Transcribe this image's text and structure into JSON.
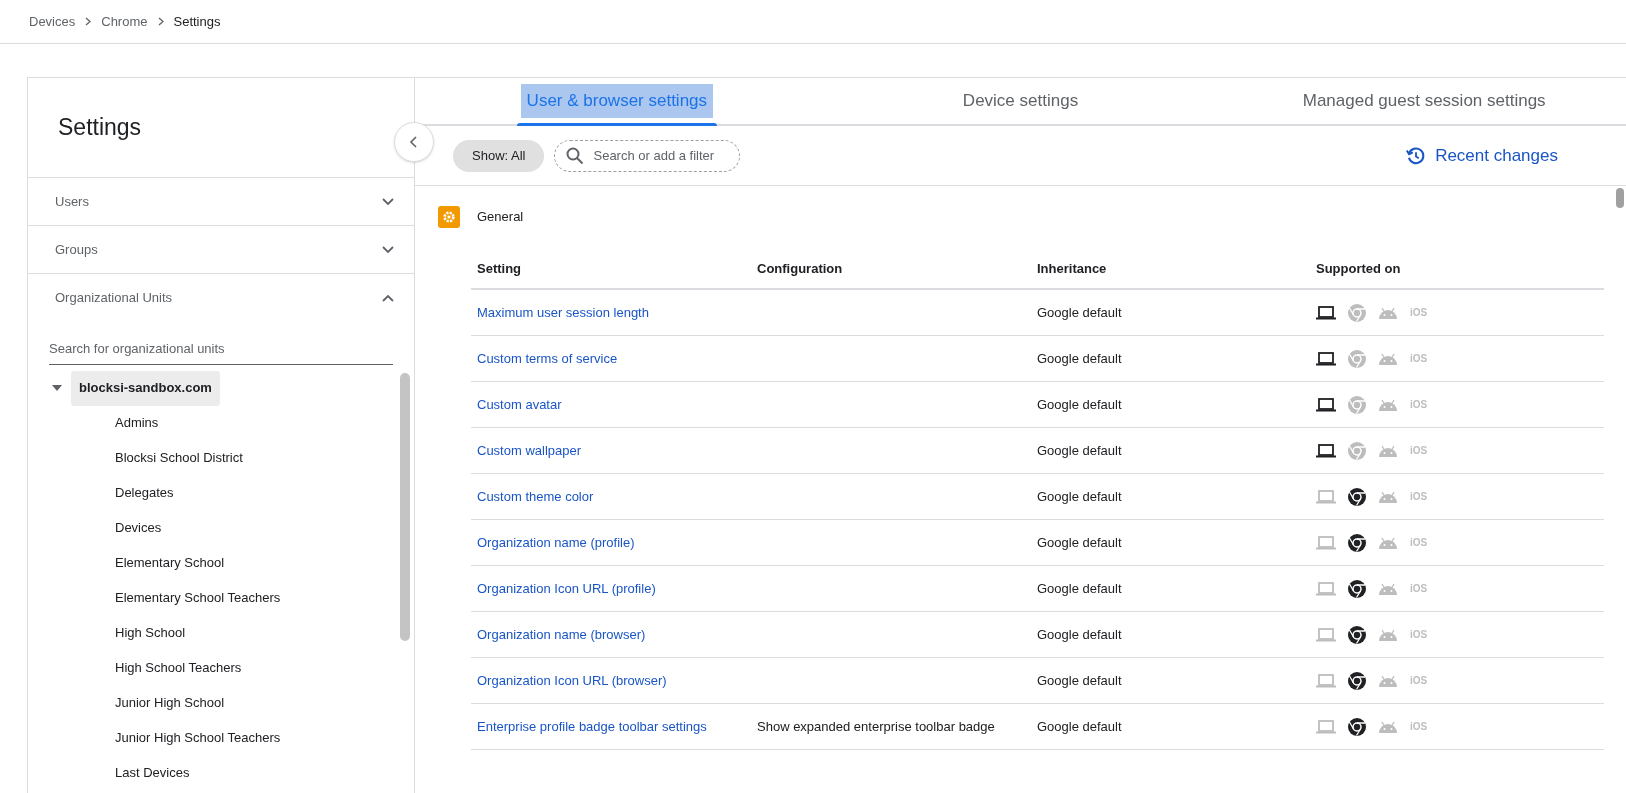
{
  "breadcrumb": [
    "Devices",
    "Chrome",
    "Settings"
  ],
  "sidebar": {
    "title": "Settings",
    "sections": [
      {
        "label": "Users",
        "expanded": false
      },
      {
        "label": "Groups",
        "expanded": false
      },
      {
        "label": "Organizational Units",
        "expanded": true
      }
    ],
    "ou_search": {
      "placeholder": "Search for organizational units"
    },
    "tree": [
      {
        "label": "blocksi-sandbox.com",
        "selected": true,
        "expanded": true,
        "children": [
          {
            "label": "Admins",
            "selected": false
          },
          {
            "label": "Blocksi School District",
            "selected": false
          },
          {
            "label": "Delegates",
            "selected": false
          },
          {
            "label": "Devices",
            "selected": false
          },
          {
            "label": "Elementary School",
            "selected": false
          },
          {
            "label": "Elementary School Teachers",
            "selected": false
          },
          {
            "label": "High School",
            "selected": false
          },
          {
            "label": "High School Teachers",
            "selected": false
          },
          {
            "label": "Junior High School",
            "selected": false
          },
          {
            "label": "Junior High School Teachers",
            "selected": false
          },
          {
            "label": "Last Devices",
            "selected": false
          }
        ]
      }
    ]
  },
  "tabs": [
    {
      "label": "User & browser settings",
      "selected": true
    },
    {
      "label": "Device settings",
      "selected": false
    },
    {
      "label": "Managed guest session settings",
      "selected": false
    }
  ],
  "toolbar": {
    "show_filter": "Show: All",
    "search": {
      "placeholder": "Search or add a filter"
    },
    "recent_changes": "Recent changes"
  },
  "category": "General",
  "table": {
    "columns": [
      "Setting",
      "Configuration",
      "Inheritance",
      "Supported on"
    ],
    "rows": [
      {
        "setting": "Maximum user session length",
        "inheritance": "Google default",
        "chromeos": true,
        "browser": false,
        "android": false,
        "ios": "iOS"
      },
      {
        "setting": "Custom terms of service",
        "inheritance": "Google default",
        "chromeos": true,
        "browser": false,
        "android": false,
        "ios": "iOS"
      },
      {
        "setting": "Custom avatar",
        "inheritance": "Google default",
        "chromeos": true,
        "browser": false,
        "android": false,
        "ios": "iOS"
      },
      {
        "setting": "Custom wallpaper",
        "inheritance": "Google default",
        "chromeos": true,
        "browser": false,
        "android": false,
        "ios": "iOS"
      },
      {
        "setting": "Custom theme color",
        "inheritance": "Google default",
        "chromeos": false,
        "browser": true,
        "android": false,
        "ios": "iOS"
      },
      {
        "setting": "Organization name (profile)",
        "inheritance": "Google default",
        "chromeos": false,
        "browser": true,
        "android": false,
        "ios": "iOS"
      },
      {
        "setting": "Organization Icon URL (profile)",
        "inheritance": "Google default",
        "chromeos": false,
        "browser": true,
        "android": false,
        "ios": "iOS"
      },
      {
        "setting": "Organization name (browser)",
        "inheritance": "Google default",
        "chromeos": false,
        "browser": true,
        "android": false,
        "ios": "iOS"
      },
      {
        "setting": "Organization Icon URL (browser)",
        "inheritance": "Google default",
        "chromeos": false,
        "browser": true,
        "android": false,
        "ios": "iOS"
      },
      {
        "setting": "Enterprise profile badge toolbar settings",
        "configuration": "Show expanded enterprise toolbar badge",
        "inheritance": "Google default",
        "chromeos": false,
        "browser": true,
        "android": false,
        "ios": "iOS"
      }
    ]
  }
}
